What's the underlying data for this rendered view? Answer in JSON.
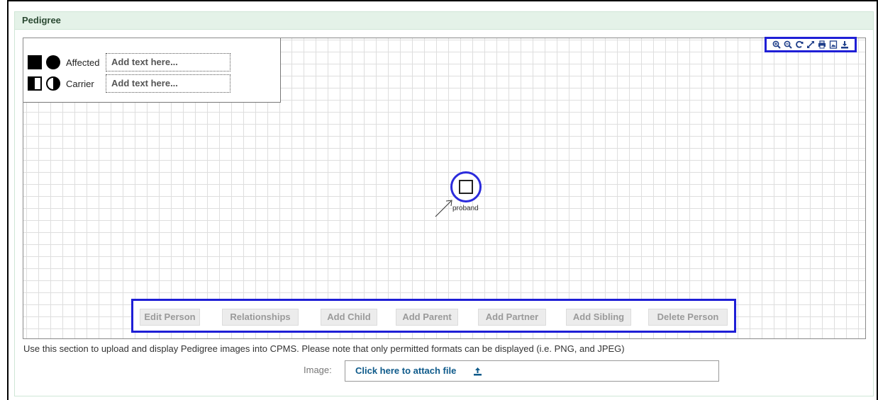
{
  "panel": {
    "title": "Pedigree"
  },
  "legend": {
    "affected_label": "Affected",
    "carrier_label": "Carrier",
    "affected_placeholder": "Add text here...",
    "carrier_placeholder": "Add text here..."
  },
  "toolbar": {
    "icons": [
      "zoom-in-icon",
      "zoom-out-icon",
      "refresh-icon",
      "fullscreen-icon",
      "print-icon",
      "image-icon",
      "download-icon"
    ]
  },
  "proband": {
    "label": "proband"
  },
  "actions": {
    "edit": "Edit Person",
    "relationships": "Relationships",
    "add_child": "Add Child",
    "add_parent": "Add Parent",
    "add_partner": "Add Partner",
    "add_sibling": "Add Sibling",
    "delete": "Delete Person"
  },
  "upload": {
    "help_text": "Use this section to upload and display Pedigree images into CPMS. Please note that only permitted formats can be displayed (i.e. PNG, and JPEG)",
    "image_label": "Image:",
    "attach_text": "Click here to attach file"
  },
  "colors": {
    "highlight_border": "#1f1fd6",
    "header_bg": "#e4f2e8",
    "link": "#0e5a8a",
    "proband_ring": "#2b2bdc"
  }
}
